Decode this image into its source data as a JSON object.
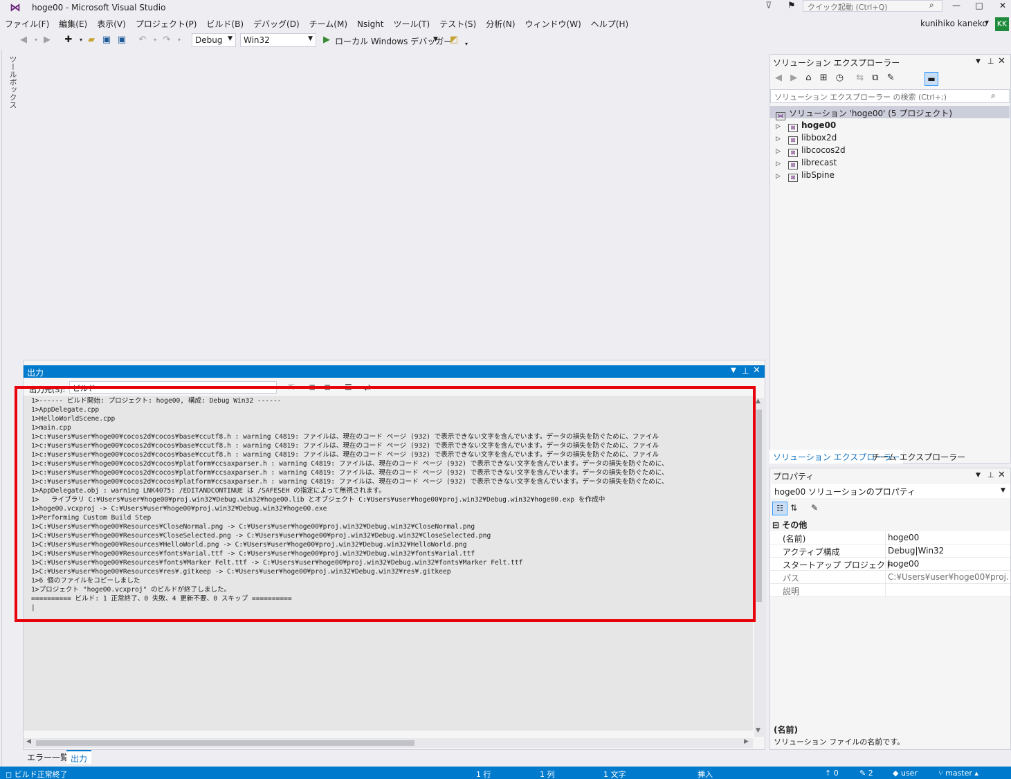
{
  "window": {
    "title": "hoge00 - Microsoft Visual Studio",
    "quick_launch_placeholder": "クイック起動 (Ctrl+Q)"
  },
  "menu": [
    "ファイル(F)",
    "編集(E)",
    "表示(V)",
    "プロジェクト(P)",
    "ビルド(B)",
    "デバッグ(D)",
    "チーム(M)",
    "Nsight",
    "ツール(T)",
    "テスト(S)",
    "分析(N)",
    "ウィンドウ(W)",
    "ヘルプ(H)"
  ],
  "user": {
    "name": "kunihiko kaneko",
    "initials": "KK"
  },
  "toolbar": {
    "configuration": "Debug",
    "platform": "Win32",
    "debugger": "ローカル Windows デバッガー"
  },
  "toolbox": {
    "label": "ツールボックス"
  },
  "output": {
    "title": "出力",
    "source_label": "出力元(S):",
    "source_value": "ビルド",
    "lines": [
      "1>------ ビルド開始: プロジェクト: hoge00, 構成: Debug Win32 ------",
      "1>AppDelegate.cpp",
      "1>HelloWorldScene.cpp",
      "1>main.cpp",
      "1>c:¥users¥user¥hoge00¥cocos2d¥cocos¥base¥ccutf8.h : warning C4819: ファイルは、現在のコード ページ (932) で表示できない文字を含んでいます。データの損失を防ぐために、ファイル",
      "1>c:¥users¥user¥hoge00¥cocos2d¥cocos¥base¥ccutf8.h : warning C4819: ファイルは、現在のコード ページ (932) で表示できない文字を含んでいます。データの損失を防ぐために、ファイル",
      "1>c:¥users¥user¥hoge00¥cocos2d¥cocos¥base¥ccutf8.h : warning C4819: ファイルは、現在のコード ページ (932) で表示できない文字を含んでいます。データの損失を防ぐために、ファイル",
      "1>c:¥users¥user¥hoge00¥cocos2d¥cocos¥platform¥ccsaxparser.h : warning C4819: ファイルは、現在のコード ページ (932) で表示できない文字を含んでいます。データの損失を防ぐために、",
      "1>c:¥users¥user¥hoge00¥cocos2d¥cocos¥platform¥ccsaxparser.h : warning C4819: ファイルは、現在のコード ページ (932) で表示できない文字を含んでいます。データの損失を防ぐために、",
      "1>c:¥users¥user¥hoge00¥cocos2d¥cocos¥platform¥ccsaxparser.h : warning C4819: ファイルは、現在のコード ページ (932) で表示できない文字を含んでいます。データの損失を防ぐために、",
      "1>AppDelegate.obj : warning LNK4075: /EDITANDCONTINUE は /SAFESEH の指定によって無視されます。",
      "1>   ライブラリ C:¥Users¥user¥hoge00¥proj.win32¥Debug.win32¥hoge00.lib とオブジェクト C:¥Users¥user¥hoge00¥proj.win32¥Debug.win32¥hoge00.exp を作成中",
      "1>hoge00.vcxproj -> C:¥Users¥user¥hoge00¥proj.win32¥Debug.win32¥hoge00.exe",
      "1>Performing Custom Build Step",
      "1>C:¥Users¥user¥hoge00¥Resources¥CloseNormal.png -> C:¥Users¥user¥hoge00¥proj.win32¥Debug.win32¥CloseNormal.png",
      "1>C:¥Users¥user¥hoge00¥Resources¥CloseSelected.png -> C:¥Users¥user¥hoge00¥proj.win32¥Debug.win32¥CloseSelected.png",
      "1>C:¥Users¥user¥hoge00¥Resources¥HelloWorld.png -> C:¥Users¥user¥hoge00¥proj.win32¥Debug.win32¥HelloWorld.png",
      "1>C:¥Users¥user¥hoge00¥Resources¥fonts¥arial.ttf -> C:¥Users¥user¥hoge00¥proj.win32¥Debug.win32¥fonts¥arial.ttf",
      "1>C:¥Users¥user¥hoge00¥Resources¥fonts¥Marker Felt.ttf -> C:¥Users¥user¥hoge00¥proj.win32¥Debug.win32¥fonts¥Marker Felt.ttf",
      "1>C:¥Users¥user¥hoge00¥Resources¥res¥.gitkeep -> C:¥Users¥user¥hoge00¥proj.win32¥Debug.win32¥res¥.gitkeep",
      "1>6 個のファイルをコピーしました",
      "1>プロジェクト \"hoge00.vcxproj\" のビルドが終了しました。",
      "========== ビルド: 1 正常終了、0 失敗、4 更新不要、0 スキップ ==========",
      "|"
    ]
  },
  "bottom_tabs": {
    "errors": "エラー一覧",
    "output": "出力"
  },
  "solution_explorer": {
    "title": "ソリューション エクスプローラー",
    "search_placeholder": "ソリューション エクスプローラー の検索 (Ctrl+;)",
    "solution_label": "ソリューション 'hoge00' (5 プロジェクト)",
    "projects": [
      "hoge00",
      "libbox2d",
      "libcocos2d",
      "librecast",
      "libSpine"
    ],
    "tab_solution": "ソリューション エクスプローラー",
    "tab_team": "チーム エクスプローラー"
  },
  "properties": {
    "title": "プロパティ",
    "object": "hoge00",
    "object_type": "ソリューションのプロパティ",
    "category": "その他",
    "rows": [
      {
        "name": "(名前)",
        "value": "hoge00"
      },
      {
        "name": "アクティブ構成",
        "value": "Debug|Win32"
      },
      {
        "name": "スタートアップ プロジェクト",
        "value": "hoge00"
      },
      {
        "name": "パス",
        "value": "C:¥Users¥user¥hoge00¥proj.win32"
      },
      {
        "name": "説明",
        "value": ""
      }
    ],
    "desc_name": "(名前)",
    "desc_text": "ソリューション ファイルの名前です。"
  },
  "statusbar": {
    "message": "ビルド正常終了",
    "line": "1 行",
    "col": "1 列",
    "char": "1 文字",
    "mode": "挿入",
    "push": "0",
    "changes": "2",
    "repo": "user",
    "branch": "master"
  }
}
